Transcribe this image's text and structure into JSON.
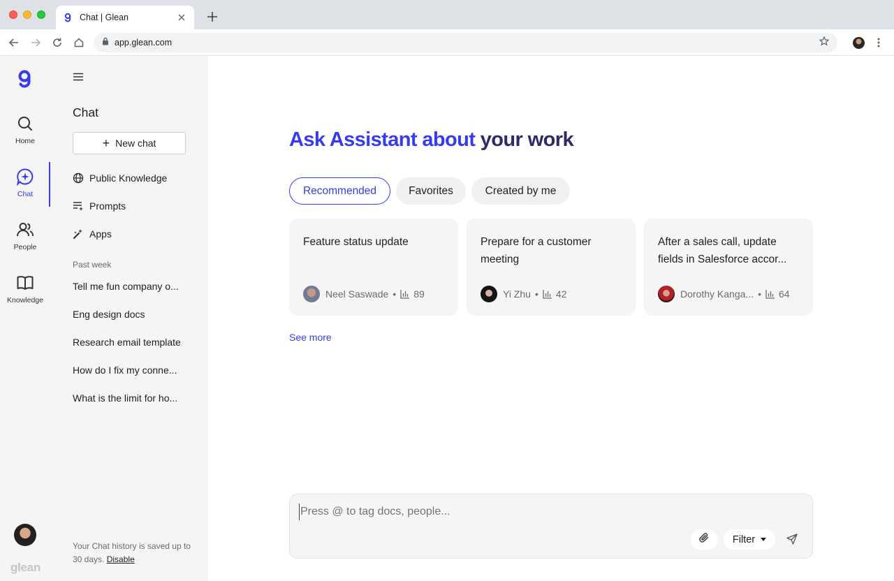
{
  "browser": {
    "tab_title": "Chat | Glean",
    "url": "app.glean.com",
    "icons": [
      "back-icon",
      "forward-icon",
      "reload-icon",
      "home-icon",
      "lock-icon",
      "star-icon",
      "menu-dots-icon"
    ]
  },
  "rail": {
    "items": [
      {
        "label": "Home",
        "icon": "search-icon"
      },
      {
        "label": "Chat",
        "icon": "chat-sparkle-icon"
      },
      {
        "label": "People",
        "icon": "people-icon"
      },
      {
        "label": "Knowledge",
        "icon": "book-icon"
      }
    ],
    "active": "Chat",
    "wordmark": "glean",
    "accent_color": "#343ced"
  },
  "sidebar": {
    "title": "Chat",
    "new_chat_label": "New chat",
    "nav": [
      {
        "label": "Public Knowledge",
        "icon": "globe-icon"
      },
      {
        "label": "Prompts",
        "icon": "prompts-icon"
      },
      {
        "label": "Apps",
        "icon": "apps-icon"
      }
    ],
    "section_label": "Past week",
    "history": [
      "Tell me fun company o...",
      "Eng design docs",
      "Research email template",
      "How do I fix my conne...",
      "What is the limit for ho..."
    ],
    "footer_text": "Your Chat history is saved up to 30 days.",
    "footer_link": "Disable"
  },
  "main": {
    "title_highlight": "Ask Assistant about ",
    "title_tail": "your work",
    "tabs": [
      {
        "label": "Recommended",
        "active": true
      },
      {
        "label": "Favorites",
        "active": false
      },
      {
        "label": "Created by me",
        "active": false
      }
    ],
    "cards": [
      {
        "title": "Feature status update",
        "author": "Neel Saswade",
        "count": "89"
      },
      {
        "title": "Prepare for a customer meeting",
        "author": "Yi Zhu",
        "count": "42"
      },
      {
        "title": "After a sales call, update fields in Salesforce accor...",
        "author": "Dorothy Kanga...",
        "count": "64"
      }
    ],
    "see_more": "See more"
  },
  "composer": {
    "placeholder": "Press @ to tag docs, people...",
    "value": "",
    "filter_label": "Filter"
  }
}
